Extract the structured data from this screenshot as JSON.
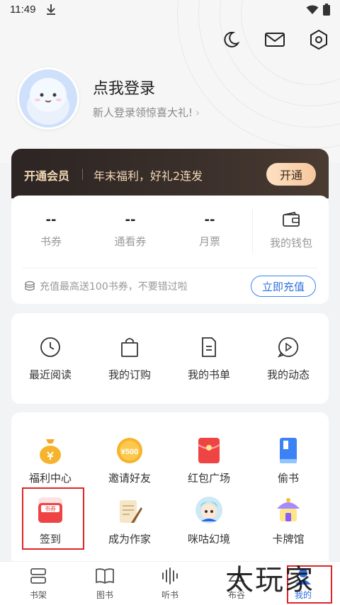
{
  "status_bar": {
    "time": "11:49"
  },
  "header": {
    "icons": [
      "moon-icon",
      "mail-icon",
      "settings-hexagon-icon"
    ]
  },
  "profile": {
    "title": "点我登录",
    "subtitle": "新人登录领惊喜大礼!",
    "chevron": "›"
  },
  "vip": {
    "title": "开通会员",
    "promo": "年末福利，好礼2连发",
    "button": "开通",
    "colors": {
      "bg": "#2c2523",
      "text": "#f3d8b6",
      "button_bg": "#f6c79d"
    }
  },
  "wallet": {
    "stats": [
      {
        "value": "--",
        "label": "书券"
      },
      {
        "value": "--",
        "label": "通看券"
      },
      {
        "value": "--",
        "label": "月票"
      }
    ],
    "wallet_label": "我的钱包",
    "recharge_tip": "充值最高送100书券，不要错过啦",
    "recharge_button": "立即充值"
  },
  "shortcuts": [
    {
      "label": "最近阅读",
      "icon": "clock-icon"
    },
    {
      "label": "我的订购",
      "icon": "shopping-bag-icon"
    },
    {
      "label": "我的书单",
      "icon": "booklist-icon"
    },
    {
      "label": "我的动态",
      "icon": "play-chat-icon"
    }
  ],
  "services": [
    {
      "label": "福利中心",
      "icon": "money-bag-icon"
    },
    {
      "label": "邀请好友",
      "icon": "coin-500-icon",
      "badge": "¥500"
    },
    {
      "label": "红包广场",
      "icon": "red-envelope-icon"
    },
    {
      "label": "偷书",
      "icon": "blue-book-icon"
    },
    {
      "label": "签到",
      "icon": "checkin-calendar-icon",
      "badge": "书券"
    },
    {
      "label": "成为作家",
      "icon": "scroll-quill-icon"
    },
    {
      "label": "咪咕幻境",
      "icon": "avatar-character-icon"
    },
    {
      "label": "卡牌馆",
      "icon": "card-house-icon"
    }
  ],
  "bottom_nav": [
    {
      "label": "书架",
      "icon": "bookshelf-icon",
      "active": false
    },
    {
      "label": "图书",
      "icon": "open-book-icon",
      "active": false
    },
    {
      "label": "听书",
      "icon": "audio-wave-icon",
      "active": false
    },
    {
      "label": "布谷",
      "icon": "bird-icon",
      "active": false
    },
    {
      "label": "我的",
      "icon": "profile-icon",
      "active": true
    }
  ],
  "watermark": "太玩家",
  "colors": {
    "accent": "#2f6fde",
    "highlight_box": "#e02424"
  }
}
